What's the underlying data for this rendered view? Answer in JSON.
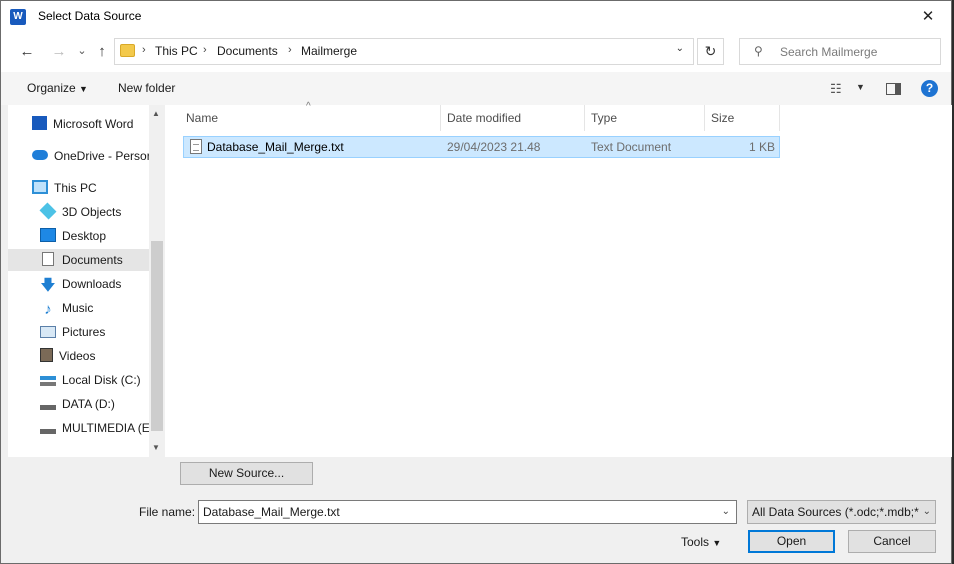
{
  "window": {
    "title": "Select Data Source",
    "app_icon": "W"
  },
  "nav": {
    "back": "←",
    "forward": "→",
    "recent": "⌄",
    "up": "↑",
    "breadcrumb": [
      "This PC",
      "Documents",
      "Mailmerge"
    ],
    "separator": "›",
    "refresh": "↻",
    "search_placeholder": "Search Mailmerge"
  },
  "toolbar": {
    "organize": "Organize",
    "new_folder": "New folder",
    "help": "?"
  },
  "sidebar": {
    "items": [
      {
        "label": "Microsoft Word",
        "icon": "word-icon"
      },
      {
        "label": "OneDrive - Persor",
        "icon": "onedrive-icon"
      },
      {
        "label": "This PC",
        "icon": "pc-icon"
      },
      {
        "label": "3D Objects",
        "icon": "cube-icon"
      },
      {
        "label": "Desktop",
        "icon": "desktop-icon"
      },
      {
        "label": "Documents",
        "icon": "document-icon",
        "selected": true
      },
      {
        "label": "Downloads",
        "icon": "download-icon"
      },
      {
        "label": "Music",
        "icon": "music-icon"
      },
      {
        "label": "Pictures",
        "icon": "pictures-icon"
      },
      {
        "label": "Videos",
        "icon": "videos-icon"
      },
      {
        "label": "Local Disk (C:)",
        "icon": "disk-icon"
      },
      {
        "label": "DATA (D:)",
        "icon": "drive-icon"
      },
      {
        "label": "MULTIMEDIA (E:",
        "icon": "drive-icon"
      }
    ]
  },
  "columns": {
    "name": "Name",
    "date": "Date modified",
    "type": "Type",
    "size": "Size"
  },
  "files": [
    {
      "name": "Database_Mail_Merge.txt",
      "date": "29/04/2023 21.48",
      "type": "Text Document",
      "size": "1 KB"
    }
  ],
  "bottom": {
    "new_source": "New Source...",
    "file_name_label": "File name:",
    "file_name_value": "Database_Mail_Merge.txt",
    "file_type_value": "All Data Sources (*.odc;*.mdb;*",
    "tools": "Tools",
    "open": "Open",
    "cancel": "Cancel"
  },
  "colors": {
    "accent": "#0078d7",
    "selection": "#cce8ff",
    "folder": "#f3c94b"
  }
}
